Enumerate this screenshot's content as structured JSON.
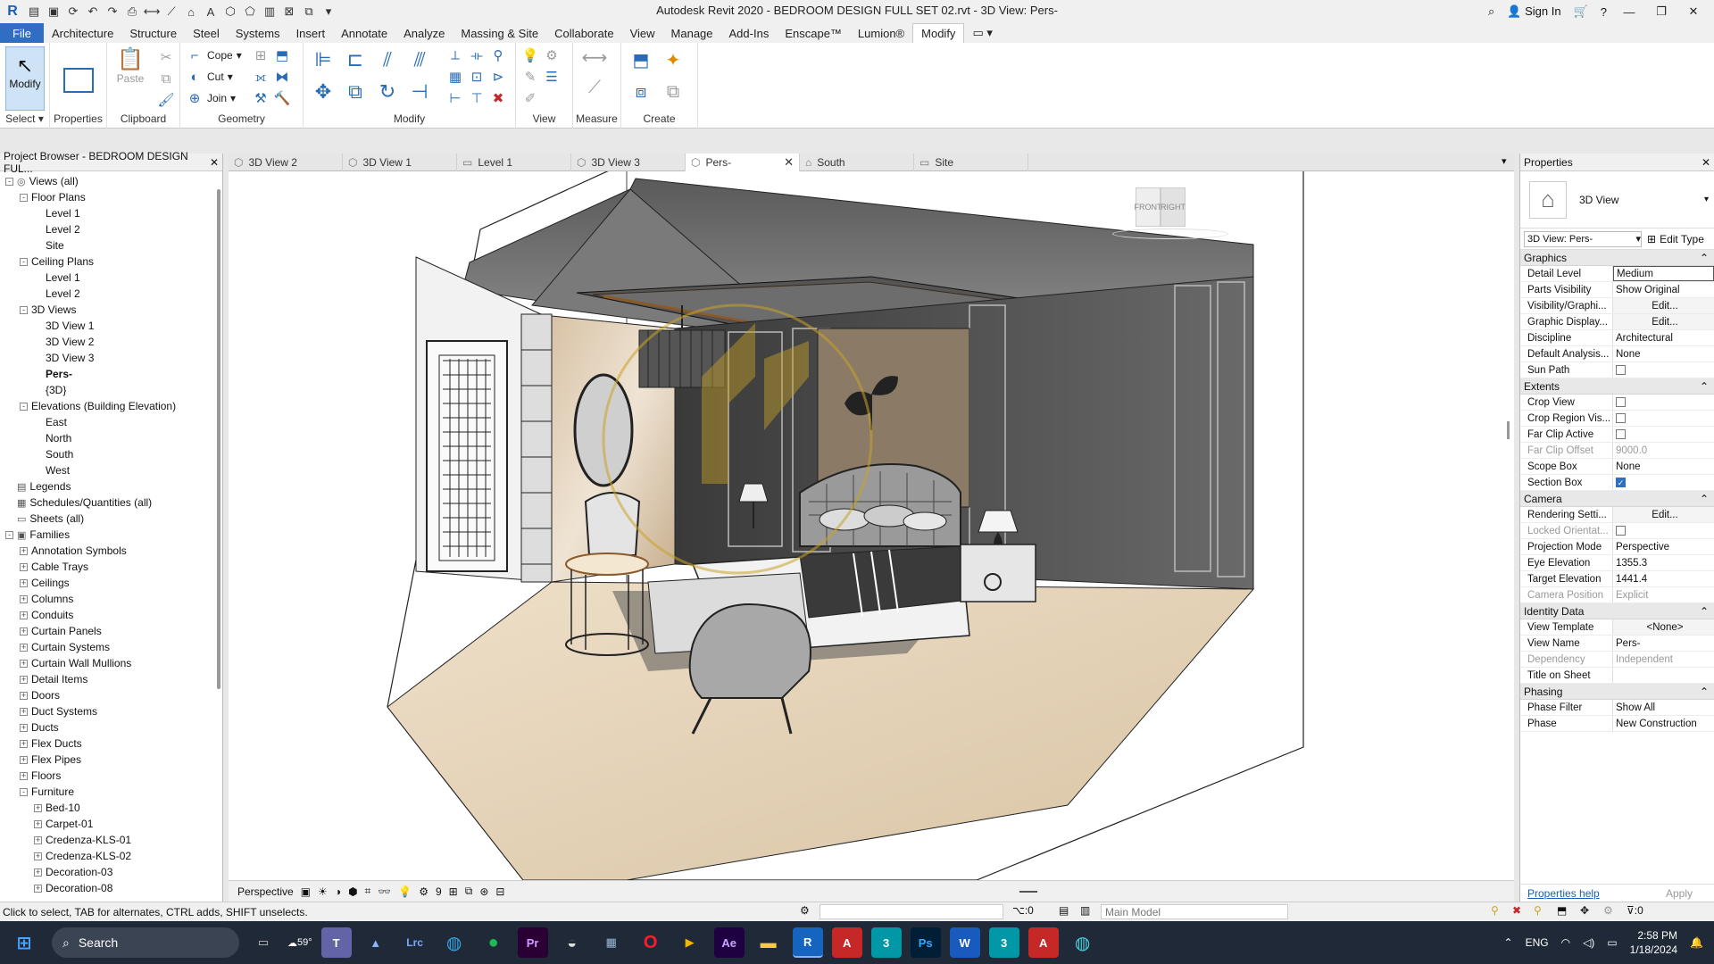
{
  "titlebar": {
    "title": "Autodesk Revit 2020 - BEDROOM DESIGN FULL SET 02.rvt - 3D View: Pers-",
    "sign_in": "Sign In"
  },
  "menu": {
    "tabs": [
      "File",
      "Architecture",
      "Structure",
      "Steel",
      "Systems",
      "Insert",
      "Annotate",
      "Analyze",
      "Massing & Site",
      "Collaborate",
      "View",
      "Manage",
      "Add-Ins",
      "Enscape™",
      "Lumion®",
      "Modify"
    ],
    "active": "Modify"
  },
  "ribbon": {
    "modify": "Modify",
    "properties": "Properties",
    "paste": "Paste",
    "cope": "Cope",
    "cut": "Cut",
    "join": "Join",
    "panels": {
      "select": "Select",
      "properties": "Properties",
      "clipboard": "Clipboard",
      "geometry": "Geometry",
      "modify": "Modify",
      "view": "View",
      "measure": "Measure",
      "create": "Create"
    }
  },
  "browser": {
    "title": "Project Browser - BEDROOM DESIGN FUL...",
    "nodes": [
      {
        "label": "Views (all)",
        "level": 0,
        "exp": "-",
        "icon": "◎"
      },
      {
        "label": "Floor Plans",
        "level": 1,
        "exp": "-"
      },
      {
        "label": "Level 1",
        "level": 2
      },
      {
        "label": "Level 2",
        "level": 2
      },
      {
        "label": "Site",
        "level": 2
      },
      {
        "label": "Ceiling Plans",
        "level": 1,
        "exp": "-"
      },
      {
        "label": "Level 1",
        "level": 2
      },
      {
        "label": "Level 2",
        "level": 2
      },
      {
        "label": "3D Views",
        "level": 1,
        "exp": "-"
      },
      {
        "label": "3D View 1",
        "level": 2
      },
      {
        "label": "3D View 2",
        "level": 2
      },
      {
        "label": "3D View 3",
        "level": 2
      },
      {
        "label": "Pers-",
        "level": 2,
        "bold": true
      },
      {
        "label": "{3D}",
        "level": 2
      },
      {
        "label": "Elevations (Building Elevation)",
        "level": 1,
        "exp": "-"
      },
      {
        "label": "East",
        "level": 2
      },
      {
        "label": "North",
        "level": 2
      },
      {
        "label": "South",
        "level": 2
      },
      {
        "label": "West",
        "level": 2
      },
      {
        "label": "Legends",
        "level": 0,
        "icon": "▤"
      },
      {
        "label": "Schedules/Quantities (all)",
        "level": 0,
        "icon": "▦"
      },
      {
        "label": "Sheets (all)",
        "level": 0,
        "icon": "▭"
      },
      {
        "label": "Families",
        "level": 0,
        "exp": "-",
        "icon": "▣"
      },
      {
        "label": "Annotation Symbols",
        "level": 1,
        "exp": "+"
      },
      {
        "label": "Cable Trays",
        "level": 1,
        "exp": "+"
      },
      {
        "label": "Ceilings",
        "level": 1,
        "exp": "+"
      },
      {
        "label": "Columns",
        "level": 1,
        "exp": "+"
      },
      {
        "label": "Conduits",
        "level": 1,
        "exp": "+"
      },
      {
        "label": "Curtain Panels",
        "level": 1,
        "exp": "+"
      },
      {
        "label": "Curtain Systems",
        "level": 1,
        "exp": "+"
      },
      {
        "label": "Curtain Wall Mullions",
        "level": 1,
        "exp": "+"
      },
      {
        "label": "Detail Items",
        "level": 1,
        "exp": "+"
      },
      {
        "label": "Doors",
        "level": 1,
        "exp": "+"
      },
      {
        "label": "Duct Systems",
        "level": 1,
        "exp": "+"
      },
      {
        "label": "Ducts",
        "level": 1,
        "exp": "+"
      },
      {
        "label": "Flex Ducts",
        "level": 1,
        "exp": "+"
      },
      {
        "label": "Flex Pipes",
        "level": 1,
        "exp": "+"
      },
      {
        "label": "Floors",
        "level": 1,
        "exp": "+"
      },
      {
        "label": "Furniture",
        "level": 1,
        "exp": "-"
      },
      {
        "label": "Bed-10",
        "level": 2,
        "exp": "+"
      },
      {
        "label": "Carpet-01",
        "level": 2,
        "exp": "+"
      },
      {
        "label": "Credenza-KLS-01",
        "level": 2,
        "exp": "+"
      },
      {
        "label": "Credenza-KLS-02",
        "level": 2,
        "exp": "+"
      },
      {
        "label": "Decoration-03",
        "level": 2,
        "exp": "+"
      },
      {
        "label": "Decoration-08",
        "level": 2,
        "exp": "+"
      }
    ]
  },
  "view_tabs": [
    {
      "label": "3D View 2",
      "icon": "⬡"
    },
    {
      "label": "3D View 1",
      "icon": "⬡"
    },
    {
      "label": "Level 1",
      "icon": "▭"
    },
    {
      "label": "3D View 3",
      "icon": "⬡"
    },
    {
      "label": "Pers-",
      "icon": "⬡",
      "active": true
    },
    {
      "label": "South",
      "icon": "⌂"
    },
    {
      "label": "Site",
      "icon": "▭"
    }
  ],
  "viewcube": {
    "front": "FRONT",
    "right": "RIGHT"
  },
  "view_control": {
    "mode": "Perspective",
    "count": "9"
  },
  "properties": {
    "title": "Properties",
    "type_name": "3D View",
    "instance": "3D View: Pers-",
    "edit_type": "Edit Type",
    "groups": [
      {
        "name": "Graphics",
        "rows": [
          {
            "k": "Detail Level",
            "v": "Medium",
            "style": "boxed"
          },
          {
            "k": "Parts Visibility",
            "v": "Show Original"
          },
          {
            "k": "Visibility/Graphi...",
            "v": "Edit...",
            "style": "btn"
          },
          {
            "k": "Graphic Display...",
            "v": "Edit...",
            "style": "btn"
          },
          {
            "k": "Discipline",
            "v": "Architectural"
          },
          {
            "k": "Default Analysis...",
            "v": "None"
          },
          {
            "k": "Sun Path",
            "check": false
          }
        ]
      },
      {
        "name": "Extents",
        "rows": [
          {
            "k": "Crop View",
            "check": false
          },
          {
            "k": "Crop Region Vis...",
            "check": false
          },
          {
            "k": "Far Clip Active",
            "check": false
          },
          {
            "k": "Far Clip Offset",
            "v": "9000.0",
            "gray": true
          },
          {
            "k": "Scope Box",
            "v": "None"
          },
          {
            "k": "Section Box",
            "check": true
          }
        ]
      },
      {
        "name": "Camera",
        "rows": [
          {
            "k": "Rendering Setti...",
            "v": "Edit...",
            "style": "btn"
          },
          {
            "k": "Locked Orientat...",
            "check": false,
            "gray": true
          },
          {
            "k": "Projection Mode",
            "v": "Perspective"
          },
          {
            "k": "Eye Elevation",
            "v": "1355.3"
          },
          {
            "k": "Target Elevation",
            "v": "1441.4"
          },
          {
            "k": "Camera Position",
            "v": "Explicit",
            "gray": true
          }
        ]
      },
      {
        "name": "Identity Data",
        "rows": [
          {
            "k": "View Template",
            "v": "<None>",
            "style": "btn"
          },
          {
            "k": "View Name",
            "v": "Pers-"
          },
          {
            "k": "Dependency",
            "v": "Independent",
            "gray": true
          },
          {
            "k": "Title on Sheet",
            "v": ""
          }
        ]
      },
      {
        "name": "Phasing",
        "rows": [
          {
            "k": "Phase Filter",
            "v": "Show All"
          },
          {
            "k": "Phase",
            "v": "New Construction"
          }
        ]
      }
    ],
    "help": "Properties help",
    "apply": "Apply"
  },
  "statusbar": {
    "hint": "Click to select, TAB for alternates, CTRL adds, SHIFT unselects.",
    "sel_count": ":0",
    "model": "Main Model",
    "filter_count": ":0"
  },
  "taskbar": {
    "search": "Search",
    "weather": "59°",
    "lang": "ENG",
    "time": "2:58 PM",
    "date": "1/18/2024"
  },
  "colors": {
    "accent": "#2f6ec2",
    "taskbar": "#1f2937",
    "gold": "#c9a227"
  }
}
